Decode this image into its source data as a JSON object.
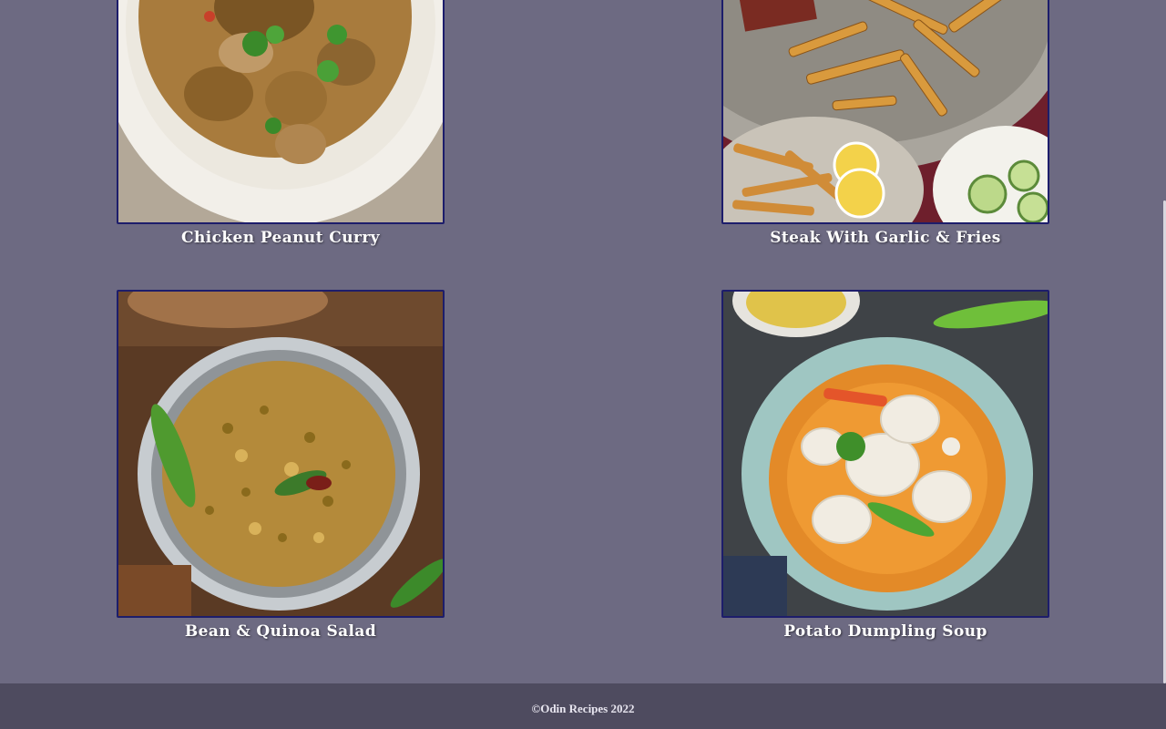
{
  "recipes": [
    {
      "title": "Chicken Peanut Curry",
      "image": "chicken-curry-bowl"
    },
    {
      "title": "Steak With Garlic & Fries",
      "image": "steak-fries-platter"
    },
    {
      "title": "Bean & Quinoa Salad",
      "image": "bean-quinoa-pot"
    },
    {
      "title": "Potato Dumpling Soup",
      "image": "dumpling-soup-bowl"
    }
  ],
  "footer": {
    "text": "©Odin Recipes 2022"
  },
  "colors": {
    "background": "#6d6a82",
    "footer_bg": "#4e4b5f",
    "image_border": "#1d1d6b",
    "caption": "#ffffff"
  }
}
